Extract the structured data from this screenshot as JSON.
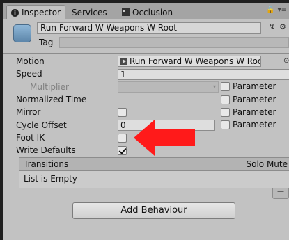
{
  "tabs": {
    "inspector": "Inspector",
    "services": "Services",
    "occlusion": "Occlusion",
    "info_glyph": "i",
    "lock_glyph": "🔒",
    "menu_glyph": "▾≡"
  },
  "header": {
    "name": "Run Forward W Weapons W Root",
    "tag_label": "Tag",
    "tag_value": "",
    "pin_glyph": "↯",
    "gear_glyph": "⚙"
  },
  "properties": {
    "motion": {
      "label": "Motion",
      "value": "Run Forward W Weapons W Root",
      "target_glyph": "⊙"
    },
    "speed": {
      "label": "Speed",
      "value": "1"
    },
    "multiplier": {
      "label": "Multiplier",
      "value": "",
      "param_label": "Parameter",
      "arrow_glyph": "▾"
    },
    "normalized_time": {
      "label": "Normalized Time",
      "param_label": "Parameter"
    },
    "mirror": {
      "label": "Mirror",
      "checked": false,
      "param_label": "Parameter"
    },
    "cycle_offset": {
      "label": "Cycle Offset",
      "value": "0",
      "param_label": "Parameter"
    },
    "foot_ik": {
      "label": "Foot IK",
      "checked": false
    },
    "write_defaults": {
      "label": "Write Defaults",
      "checked": true
    }
  },
  "transitions": {
    "title": "Transitions",
    "columns": "Solo Mute",
    "empty_text": "List is Empty",
    "remove_glyph": "—"
  },
  "add_behaviour": {
    "label": "Add Behaviour"
  },
  "colors": {
    "panel_bg": "#c2c2c2",
    "arrow_red": "#ff1a1a",
    "window_bg": "#1f1f1f"
  }
}
